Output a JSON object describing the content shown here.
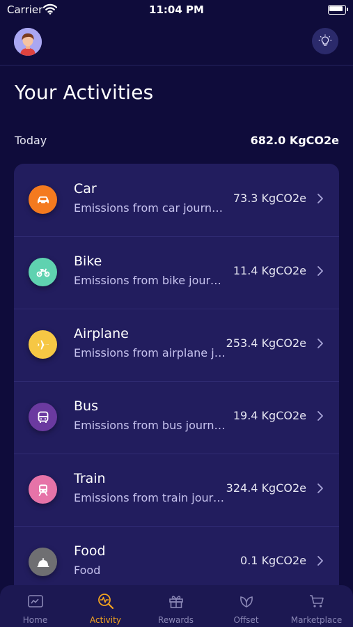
{
  "status_bar": {
    "carrier": "Carrier",
    "time": "11:04 PM"
  },
  "header": {
    "avatar_icon": "user-avatar-icon",
    "action_icon": "lightbulb-icon"
  },
  "page": {
    "title": "Your Activities"
  },
  "summary": {
    "label": "Today",
    "total": "682.0 KgCO2e"
  },
  "activities": [
    {
      "title": "Car",
      "subtitle": "Emissions from car journeys",
      "value": "73.3 KgCO2e",
      "icon": "car-icon",
      "color": "#f47a1f"
    },
    {
      "title": "Bike",
      "subtitle": "Emissions from bike journeys",
      "value": "11.4 KgCO2e",
      "icon": "motorbike-icon",
      "color": "#5fd2b0"
    },
    {
      "title": "Airplane",
      "subtitle": "Emissions from airplane journeys",
      "value": "253.4 KgCO2e",
      "icon": "airplane-icon",
      "color": "#f6c744"
    },
    {
      "title": "Bus",
      "subtitle": "Emissions from bus journeys",
      "value": "19.4 KgCO2e",
      "icon": "bus-icon",
      "color": "#6b3aa0"
    },
    {
      "title": "Train",
      "subtitle": "Emissions from train journeys",
      "value": "324.4 KgCO2e",
      "icon": "train-icon",
      "color": "#e673a8"
    },
    {
      "title": "Food",
      "subtitle": "Food",
      "value": "0.1 KgCO2e",
      "icon": "food-icon",
      "color": "#6f6f72"
    }
  ],
  "tabs": [
    {
      "label": "Home",
      "icon": "home-icon",
      "active": false
    },
    {
      "label": "Activity",
      "icon": "activity-search-icon",
      "active": true
    },
    {
      "label": "Rewards",
      "icon": "gift-icon",
      "active": false
    },
    {
      "label": "Offset",
      "icon": "leaf-icon",
      "active": false
    },
    {
      "label": "Marketplace",
      "icon": "cart-icon",
      "active": false
    }
  ],
  "colors": {
    "background": "#0f0c3b",
    "card": "#221d5e",
    "accent": "#f3a31f",
    "tab_inactive": "#8b88b6"
  }
}
